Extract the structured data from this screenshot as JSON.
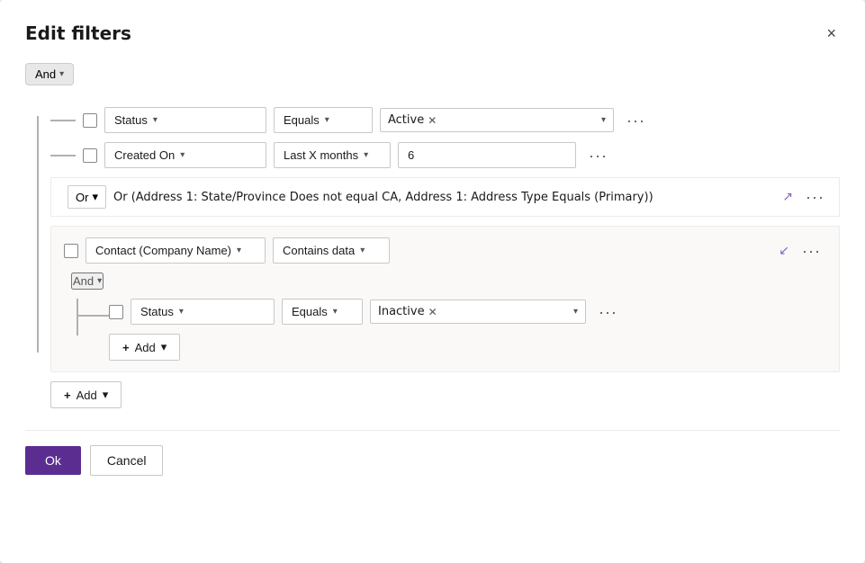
{
  "dialog": {
    "title": "Edit filters",
    "close_label": "×"
  },
  "root_operator": {
    "label": "And",
    "chevron": "▾"
  },
  "filter_rows": [
    {
      "id": "row1",
      "field": "Status",
      "operator": "Equals",
      "value_tag": "Active",
      "more": "···"
    },
    {
      "id": "row2",
      "field": "Created On",
      "operator": "Last X months",
      "value_text": "6",
      "more": "···"
    }
  ],
  "or_group": {
    "operator_label": "Or",
    "operator_chevron": "▾",
    "description": "Or (Address 1: State/Province Does not equal CA, Address 1: Address Type Equals (Primary))",
    "expand_icon": "↗",
    "more": "···"
  },
  "nested_group": {
    "header_field": "Contact (Company Name)",
    "header_operator": "Contains data",
    "collapse_icon": "↙",
    "more": "···",
    "and_label": "And",
    "and_chevron": "▾",
    "nested_row": {
      "field": "Status",
      "operator": "Equals",
      "value_tag": "Inactive",
      "more": "···"
    },
    "add_button": {
      "label": "Add",
      "plus": "+",
      "chevron": "▾"
    }
  },
  "root_add_button": {
    "label": "Add",
    "plus": "+",
    "chevron": "▾"
  },
  "footer": {
    "ok_label": "Ok",
    "cancel_label": "Cancel"
  }
}
